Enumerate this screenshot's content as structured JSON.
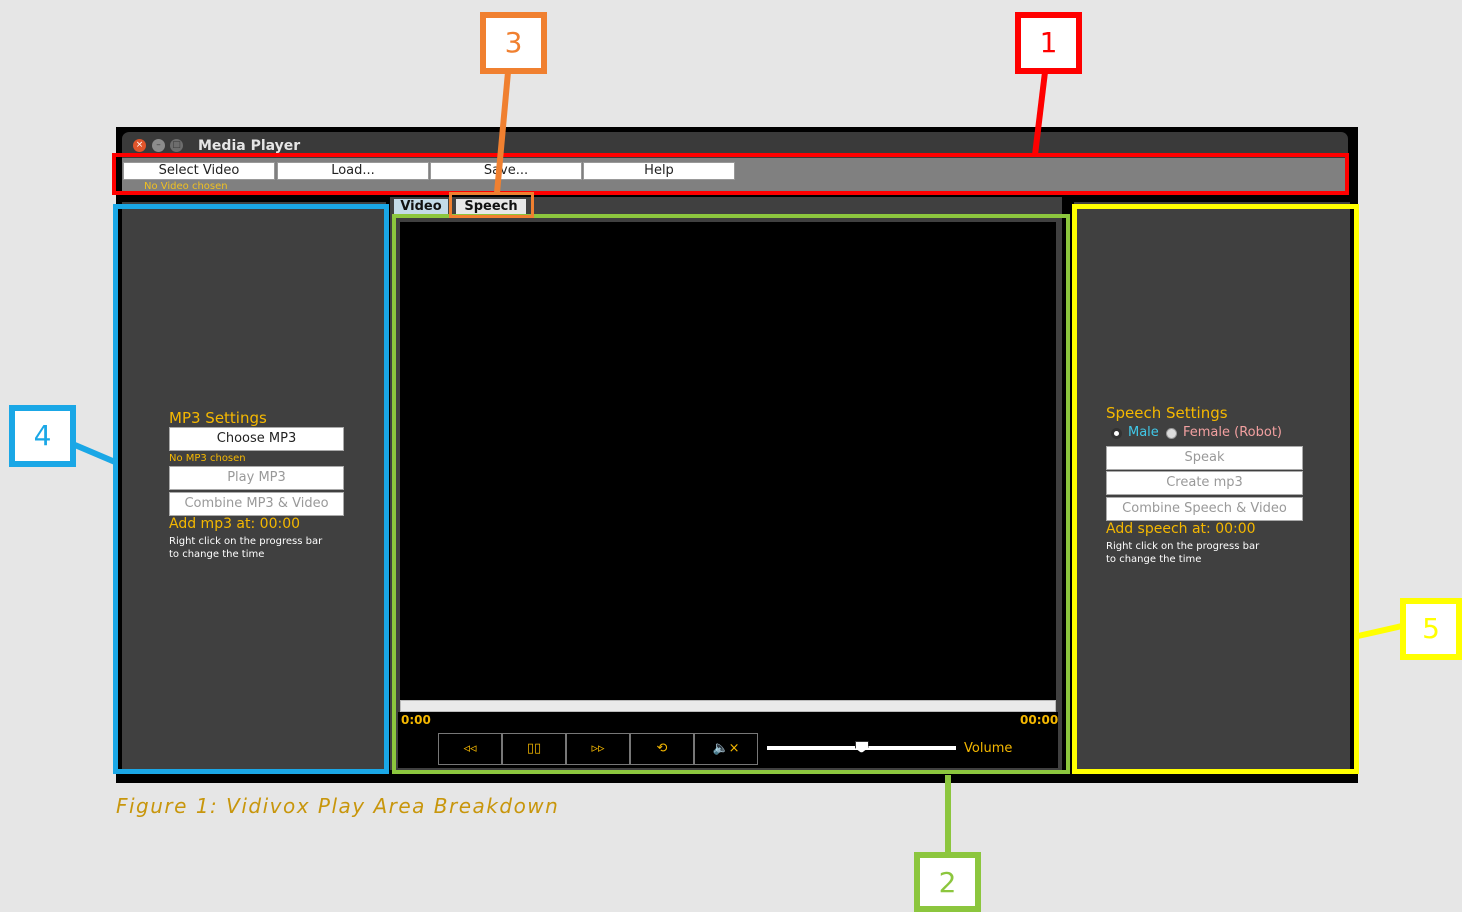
{
  "window": {
    "title": "Media Player"
  },
  "menu": {
    "items": [
      "Select Video",
      "Load...",
      "Save...",
      "Help"
    ],
    "status": "No Video chosen"
  },
  "tabs": [
    "Video",
    "Speech"
  ],
  "mp3_panel": {
    "title": "MP3 Settings",
    "choose_label": "Choose MP3",
    "status": "No MP3 chosen",
    "play_label": "Play MP3",
    "combine_label": "Combine MP3 & Video",
    "add_at": "Add mp3 at: 00:00",
    "hint_line1": "Right click on the progress bar",
    "hint_line2": "to change the time"
  },
  "player": {
    "time_current": "0:00",
    "time_total": "00:00",
    "volume_label": "Volume",
    "volume_level": 0.5,
    "controls": [
      {
        "name": "rewind",
        "glyph": "◃◃"
      },
      {
        "name": "pause",
        "glyph": "▯▯"
      },
      {
        "name": "fast-forward",
        "glyph": "▹▹"
      },
      {
        "name": "loop",
        "glyph": "⟲"
      },
      {
        "name": "mute",
        "glyph": "🔈×"
      }
    ]
  },
  "speech_panel": {
    "title": "Speech Settings",
    "voice_male": "Male",
    "voice_female": "Female (Robot)",
    "speak_label": "Speak",
    "create_label": "Create mp3",
    "combine_label": "Combine Speech & Video",
    "add_at": "Add speech at: 00:00",
    "hint_line1": "Right click on the progress bar",
    "hint_line2": "to change the time"
  },
  "annotations": [
    "1",
    "2",
    "3",
    "4",
    "5"
  ],
  "caption": "Figure 1: Vidivox Play Area Breakdown",
  "colors": {
    "box1": "#ff0000",
    "box2": "#8cc63e",
    "box3": "#f08030",
    "box4": "#1aa7e6",
    "box5": "#ffff00",
    "accent": "#f5b800"
  }
}
